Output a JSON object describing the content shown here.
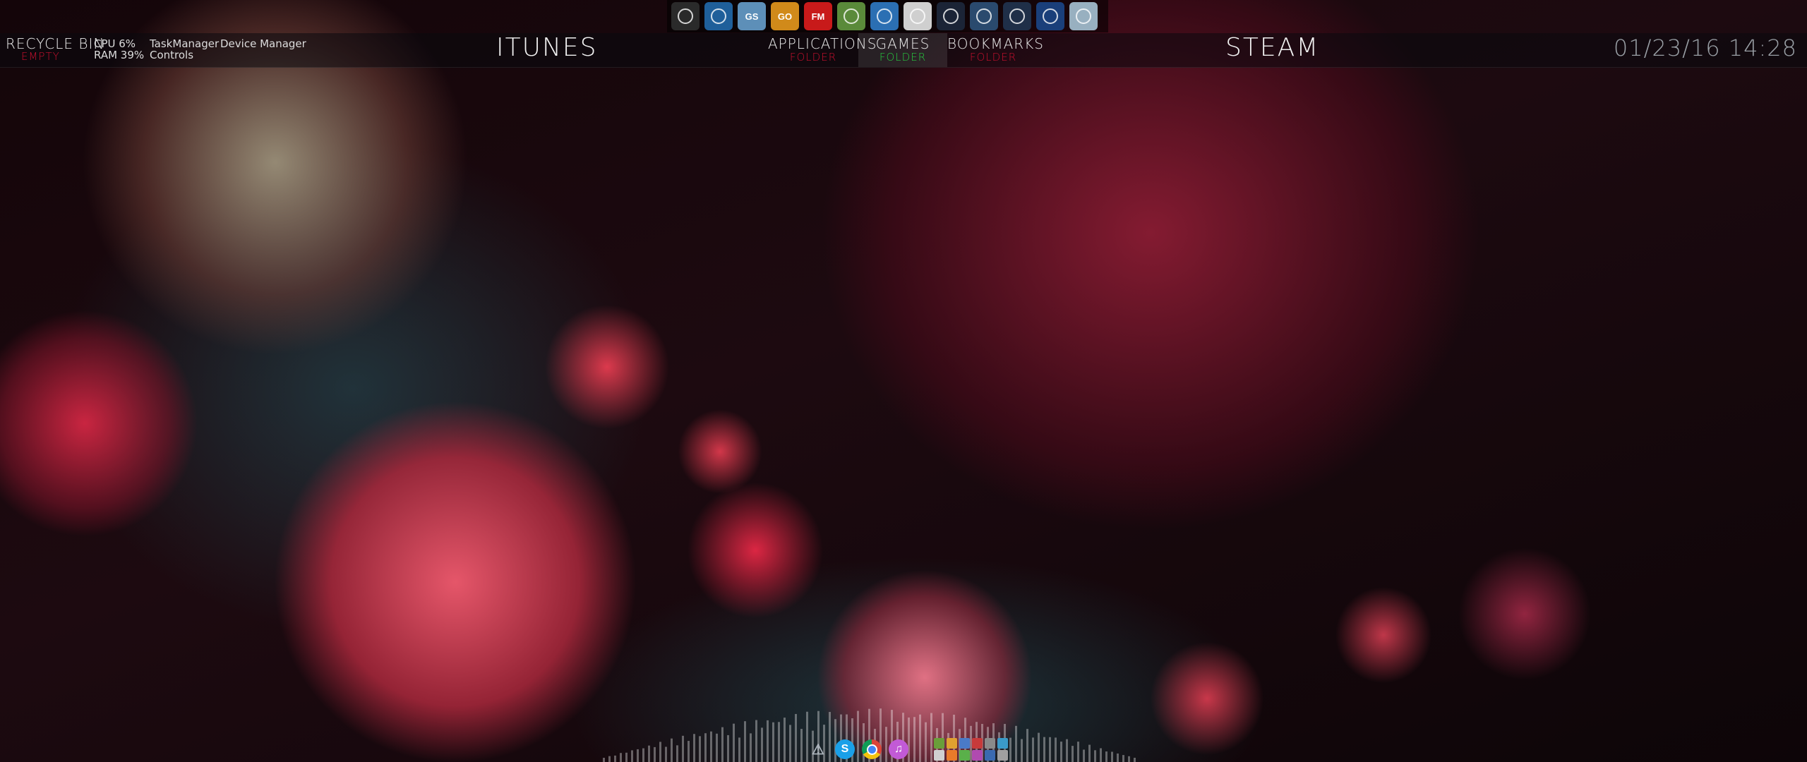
{
  "dock": {
    "icons": [
      {
        "name": "arma-icon",
        "label": "",
        "bg": "#2a2a2a"
      },
      {
        "name": "app-swirl-icon",
        "label": "",
        "bg": "#1f5f9a"
      },
      {
        "name": "gs-icon",
        "label": "GS",
        "bg": "#5d8fb8"
      },
      {
        "name": "csgo-icon",
        "label": "GO",
        "bg": "#d18a1a"
      },
      {
        "name": "fm-icon",
        "label": "FM",
        "bg": "#c81a1a"
      },
      {
        "name": "minecraft-icon",
        "label": "",
        "bg": "#5a8a3a"
      },
      {
        "name": "rocket-league-icon",
        "label": "",
        "bg": "#2b6fb3"
      },
      {
        "name": "hitman-icon",
        "label": "",
        "bg": "#cfcfcf"
      },
      {
        "name": "star-citizen-icon",
        "label": "",
        "bg": "#1b2436"
      },
      {
        "name": "steam-icon",
        "label": "",
        "bg": "#2a4a6e"
      },
      {
        "name": "teamspeak-icon",
        "label": "",
        "bg": "#1f2f48"
      },
      {
        "name": "uplay-icon",
        "label": "",
        "bg": "#1a3f7a"
      },
      {
        "name": "warframe-icon",
        "label": "",
        "bg": "#98b0c0"
      }
    ]
  },
  "topbar": {
    "recycle_bin": "RECYCLE BIN",
    "recycle_sub": "EMPTY",
    "cpu": "CPU 6%",
    "ram": "RAM 39%",
    "task_manager": "TaskManager",
    "device_manager": "Device Manager",
    "controls": "Controls",
    "itunes": "ITUNES",
    "applications": "APPLICATIONS",
    "applications_sub": "FOLDER",
    "games": "GAMES",
    "games_sub": "FOLDER",
    "bookmarks": "BOOKMARKS",
    "bookmarks_sub": "FOLDER",
    "steam": "STEAM",
    "datetime": "01/23/16  14:28"
  },
  "taskbar": {
    "icons": [
      {
        "name": "alert-triangle-icon",
        "label": "⚠",
        "bg": "transparent"
      },
      {
        "name": "skype-icon",
        "label": "S",
        "bg": "#1aa0e8"
      },
      {
        "name": "chrome-icon",
        "label": "",
        "bg": "#dd4b39"
      },
      {
        "name": "itunes-icon",
        "label": "♫",
        "bg": "#c25ad6"
      }
    ],
    "tray_colors": [
      "#6a9e3a",
      "#e0a030",
      "#4a7ac8",
      "#c83a3a",
      "#8a8a8a",
      "#3a9ac8",
      "#d0d0d0",
      "#e87a2a",
      "#5ab04a",
      "#b04ab0",
      "#3a6ab0",
      "#a0a0a0"
    ]
  },
  "colors": {
    "recycle_sub": "#c8102e",
    "applications_sub": "#c8102e",
    "games_sub": "#27c93f",
    "bookmarks_sub": "#c8102e",
    "games_highlight": "rgba(255,255,255,0.10)"
  }
}
